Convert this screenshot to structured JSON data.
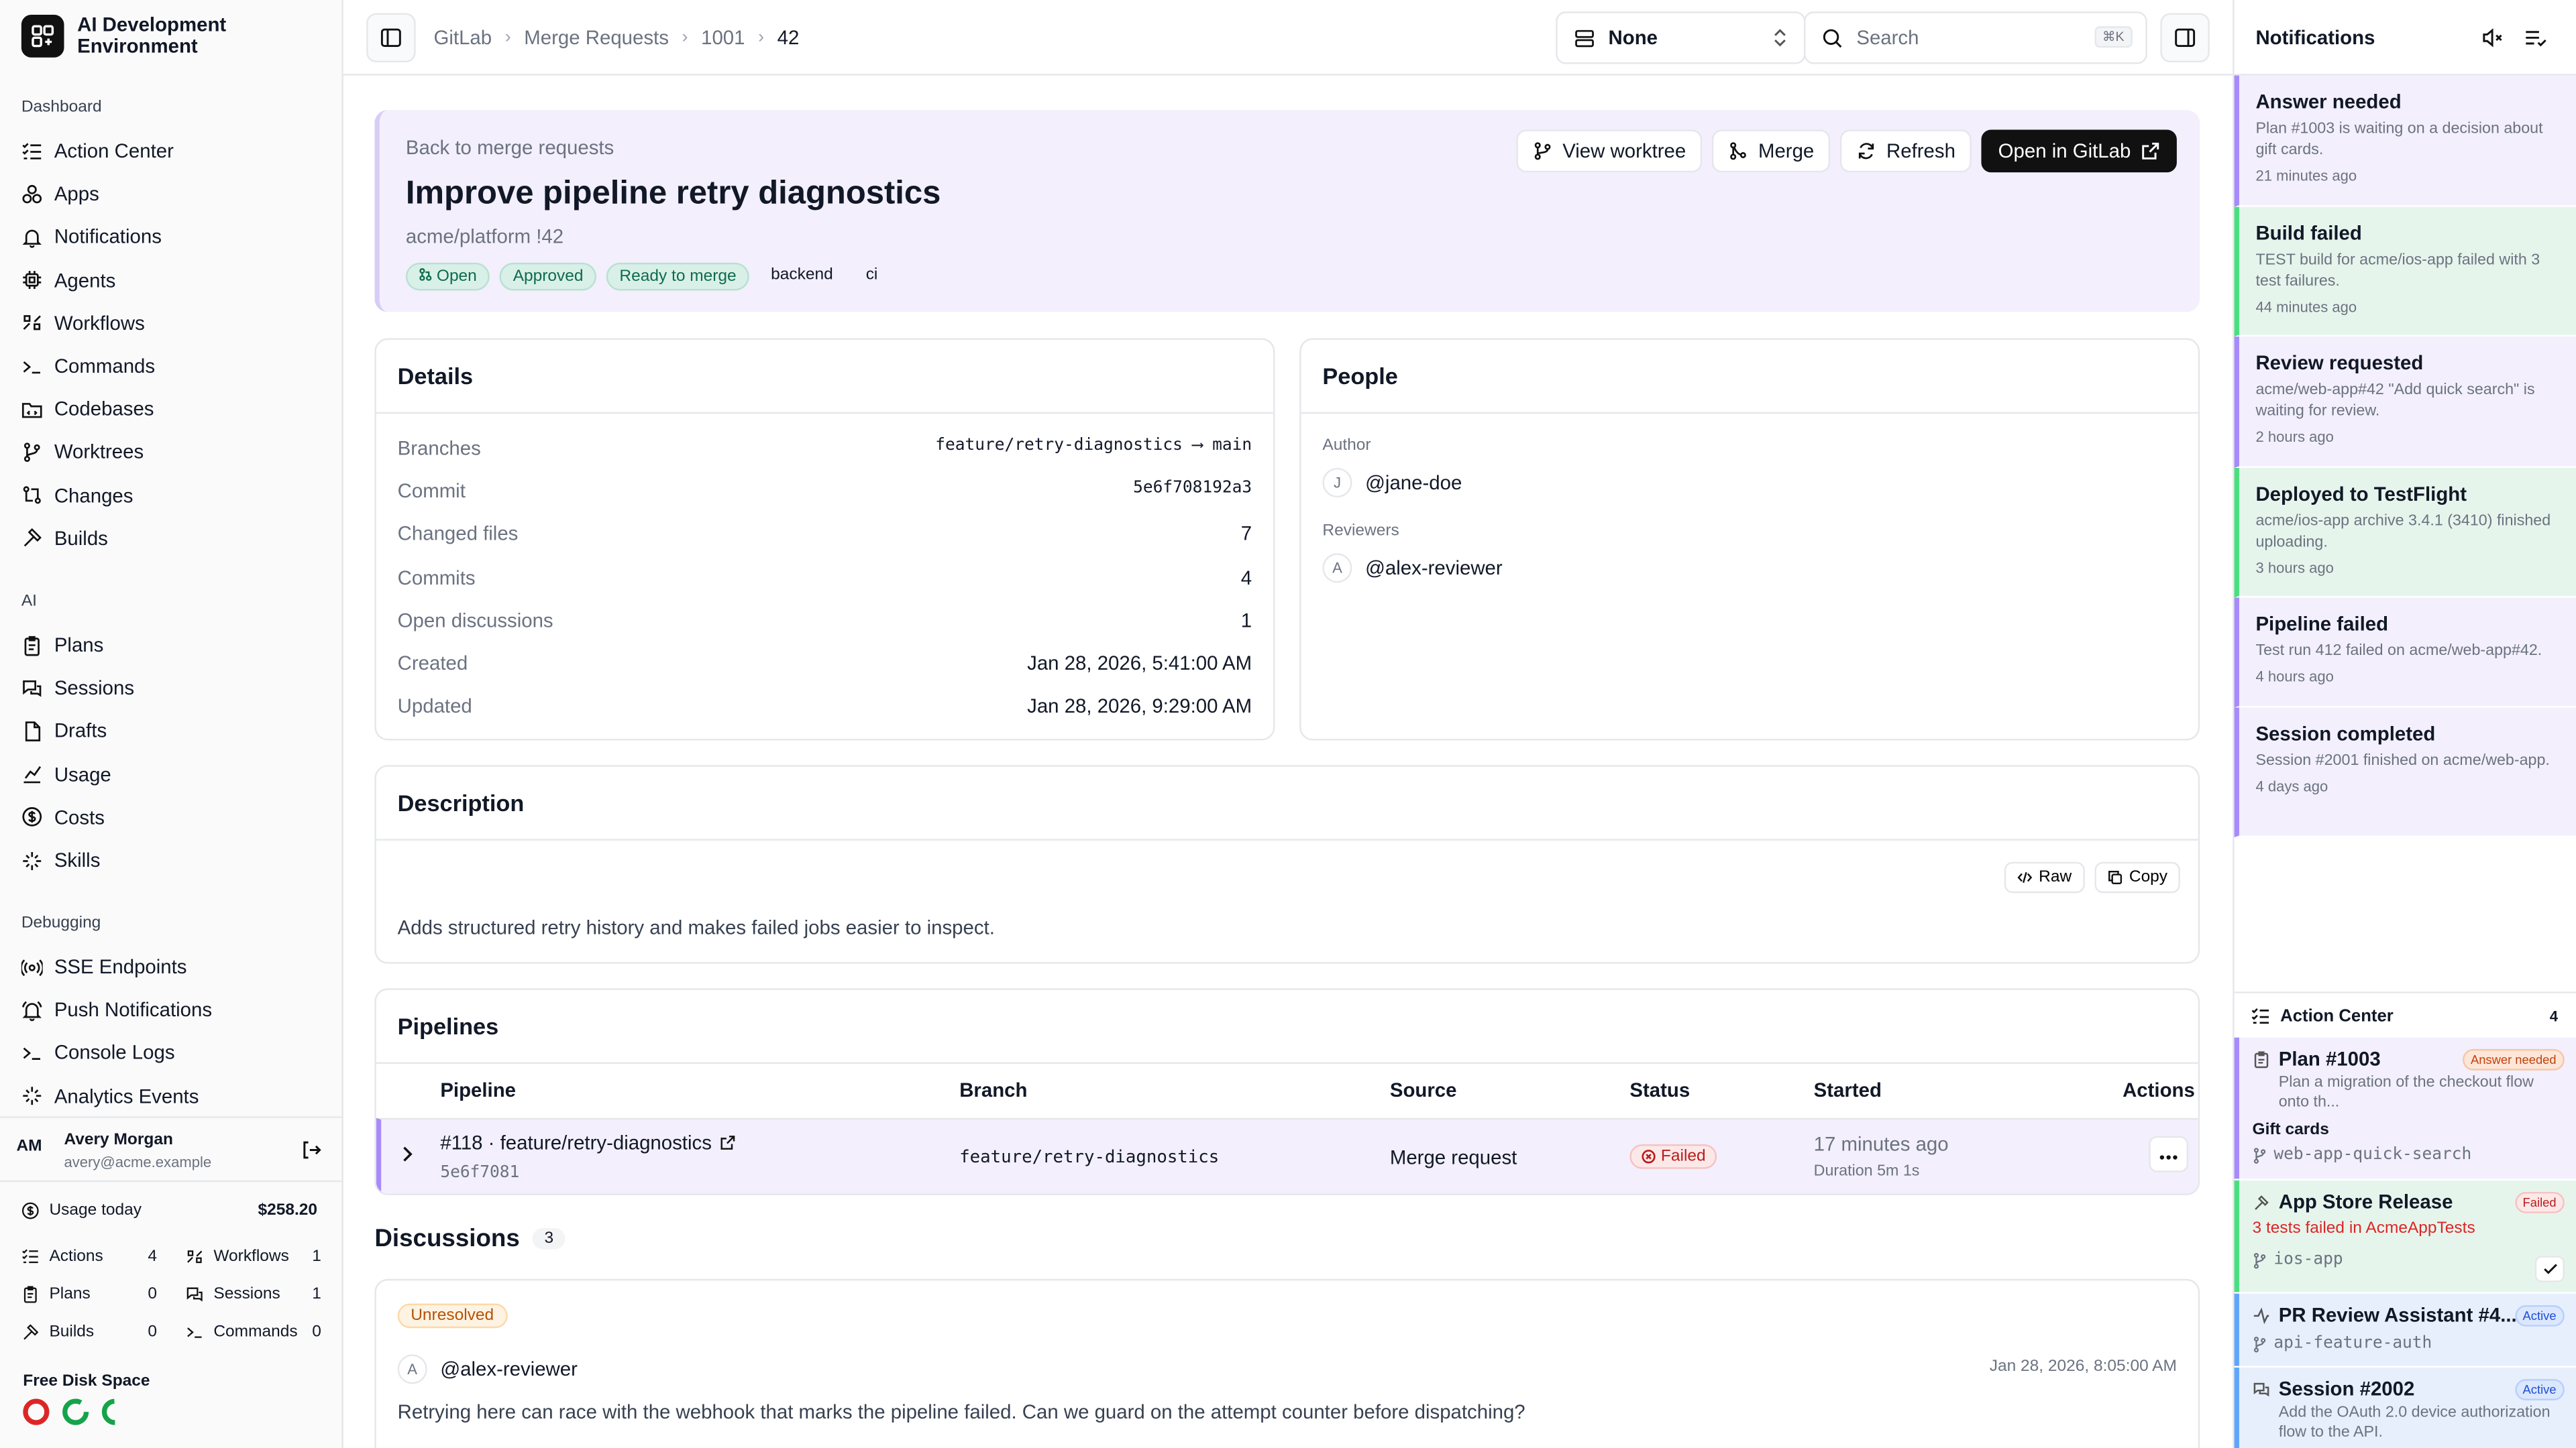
{
  "app": {
    "title": "AI Development Environment"
  },
  "sidebar": {
    "sections": {
      "dashboard": "Dashboard",
      "ai": "AI",
      "debugging": "Debugging"
    },
    "dashboard_items": [
      {
        "label": "Action Center",
        "icon": "list-check-icon"
      },
      {
        "label": "Apps",
        "icon": "apps-icon"
      },
      {
        "label": "Notifications",
        "icon": "bell-icon"
      },
      {
        "label": "Agents",
        "icon": "cpu-icon"
      },
      {
        "label": "Workflows",
        "icon": "workflow-icon"
      },
      {
        "label": "Commands",
        "icon": "terminal-icon"
      },
      {
        "label": "Codebases",
        "icon": "folder-code-icon"
      },
      {
        "label": "Worktrees",
        "icon": "git-branch-icon"
      },
      {
        "label": "Changes",
        "icon": "git-compare-icon"
      },
      {
        "label": "Builds",
        "icon": "hammer-icon"
      }
    ],
    "ai_items": [
      {
        "label": "Plans",
        "icon": "clipboard-icon"
      },
      {
        "label": "Sessions",
        "icon": "chat-icon"
      },
      {
        "label": "Drafts",
        "icon": "file-icon"
      },
      {
        "label": "Usage",
        "icon": "chart-icon"
      },
      {
        "label": "Costs",
        "icon": "dollar-icon"
      },
      {
        "label": "Skills",
        "icon": "sparkle-icon"
      }
    ],
    "debug_items": [
      {
        "label": "SSE Endpoints",
        "icon": "radio-icon"
      },
      {
        "label": "Push Notifications",
        "icon": "bell-ring-icon"
      },
      {
        "label": "Console Logs",
        "icon": "terminal-icon"
      },
      {
        "label": "Analytics Events",
        "icon": "sparkle-icon"
      }
    ],
    "user": {
      "initials": "AM",
      "name": "Avery Morgan",
      "email": "avery@acme.example"
    },
    "usage": {
      "label": "Usage today",
      "value": "$258.20",
      "stats": [
        {
          "label": "Actions",
          "value": "4"
        },
        {
          "label": "Workflows",
          "value": "1"
        },
        {
          "label": "Plans",
          "value": "0"
        },
        {
          "label": "Sessions",
          "value": "1"
        },
        {
          "label": "Builds",
          "value": "0"
        },
        {
          "label": "Commands",
          "value": "0"
        }
      ]
    },
    "disk": {
      "label": "Free Disk Space"
    }
  },
  "topbar": {
    "breadcrumbs": [
      "GitLab",
      "Merge Requests",
      "1001",
      "42"
    ],
    "select_value": "None",
    "search_placeholder": "Search",
    "shortcut": "⌘K"
  },
  "mr": {
    "back": "Back to merge requests",
    "title": "Improve pipeline retry diagnostics",
    "ref": "acme/platform !42",
    "badges": {
      "open": "Open",
      "approved": "Approved",
      "ready": "Ready to merge",
      "l1": "backend",
      "l2": "ci"
    },
    "actions": {
      "worktree": "View worktree",
      "merge": "Merge",
      "refresh": "Refresh",
      "open": "Open in GitLab"
    }
  },
  "details": {
    "title": "Details",
    "rows": [
      {
        "k": "Branches",
        "v": "feature/retry-diagnostics ⟶ main"
      },
      {
        "k": "Commit",
        "v": "5e6f708192a3"
      },
      {
        "k": "Changed files",
        "v": "7"
      },
      {
        "k": "Commits",
        "v": "4"
      },
      {
        "k": "Open discussions",
        "v": "1"
      },
      {
        "k": "Created",
        "v": "Jan 28, 2026, 5:41:00 AM"
      },
      {
        "k": "Updated",
        "v": "Jan 28, 2026, 9:29:00 AM"
      }
    ]
  },
  "people": {
    "title": "People",
    "author_label": "Author",
    "author_initial": "J",
    "author": "@jane-doe",
    "reviewers_label": "Reviewers",
    "reviewer_initial": "A",
    "reviewer": "@alex-reviewer"
  },
  "description": {
    "title": "Description",
    "raw": "Raw",
    "copy": "Copy",
    "text": "Adds structured retry history and makes failed jobs easier to inspect."
  },
  "pipelines": {
    "title": "Pipelines",
    "headers": {
      "pipeline": "Pipeline",
      "branch": "Branch",
      "source": "Source",
      "status": "Status",
      "started": "Started",
      "actions": "Actions"
    },
    "row": {
      "name": "#118 · feature/retry-diagnostics",
      "sha": "5e6f7081",
      "branch": "feature/retry-diagnostics",
      "source": "Merge request",
      "status": "Failed",
      "started": "17 minutes ago",
      "duration": "Duration 5m 1s"
    }
  },
  "discussions": {
    "title": "Discussions",
    "count": "3",
    "item": {
      "status": "Unresolved",
      "initial": "A",
      "author": "@alex-reviewer",
      "time": "Jan 28, 2026, 8:05:00 AM",
      "text": "Retrying here can race with the webhook that marks the pipeline failed. Can we guard on the attempt counter before dispatching?"
    }
  },
  "notifications": {
    "title": "Notifications",
    "items": [
      {
        "title": "Answer needed",
        "body": "Plan #1003 is waiting on a decision about gift cards.",
        "time": "21 minutes ago",
        "color": "purple"
      },
      {
        "title": "Build failed",
        "body": "TEST build for acme/ios-app failed with 3 test failures.",
        "time": "44 minutes ago",
        "color": "green"
      },
      {
        "title": "Review requested",
        "body": "acme/web-app#42 \"Add quick search\" is waiting for review.",
        "time": "2 hours ago",
        "color": "purple"
      },
      {
        "title": "Deployed to TestFlight",
        "body": "acme/ios-app archive 3.4.1 (3410) finished uploading.",
        "time": "3 hours ago",
        "color": "green"
      },
      {
        "title": "Pipeline failed",
        "body": "Test run 412 failed on acme/web-app#42.",
        "time": "4 hours ago",
        "color": "purple"
      },
      {
        "title": "Session completed",
        "body": "Session #2001 finished on acme/web-app.",
        "time": "4 days ago",
        "color": "purple"
      }
    ]
  },
  "action_center": {
    "title": "Action Center",
    "count": "4",
    "items": [
      {
        "title": "Plan #1003",
        "tag": "Answer needed",
        "sub": "Plan a migration of the checkout flow onto th...",
        "extra": "Gift cards",
        "branch": "web-app-quick-search"
      },
      {
        "title": "App Store Release",
        "tag": "Failed",
        "sub": "3 tests failed in AcmeAppTests",
        "branch": "ios-app"
      },
      {
        "title": "PR Review Assistant #4...",
        "tag": "Active",
        "branch": "api-feature-auth"
      },
      {
        "title": "Session #2002",
        "tag": "Active",
        "sub": "Add the OAuth 2.0 device authorization flow to the API."
      }
    ]
  },
  "colors": {
    "accent_purple": "#a78bfa",
    "success_green": "#4ade80",
    "danger": "#dc2626",
    "info_blue": "#60a5fa"
  }
}
